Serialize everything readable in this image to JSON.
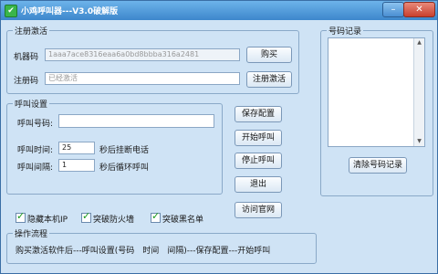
{
  "window": {
    "title": "小鸡呼叫器---V3.0破解版",
    "minimize_label": "–",
    "close_label": "✕",
    "app_icon_glyph": "✔"
  },
  "registration": {
    "legend": "注册激活",
    "machine_label": "机器码",
    "machine_value": "1aaa7ace8316eaa6a0bd8bbba316a2481",
    "buy_label": "购买",
    "code_label": "注册码",
    "code_placeholder": "已经激活",
    "register_label": "注册激活"
  },
  "call_settings": {
    "legend": "呼叫设置",
    "number_label": "呼叫号码:",
    "number_value": "",
    "time_label": "呼叫时间:",
    "time_value": "25",
    "time_suffix": "秒后挂断电话",
    "interval_label": "呼叫间隔:",
    "interval_value": "1",
    "interval_suffix": "秒后循环呼叫"
  },
  "actions": {
    "save_label": "保存配置",
    "start_label": "开始呼叫",
    "stop_label": "停止呼叫",
    "exit_label": "退出",
    "visit_label": "访问官网"
  },
  "options": {
    "hide_ip_label": "隐藏本机IP",
    "hide_ip_checked": true,
    "firewall_label": "突破防火墙",
    "firewall_checked": true,
    "blacklist_label": "突破黑名单",
    "blacklist_checked": true
  },
  "workflow": {
    "legend": "操作流程",
    "text": "购买激活软件后---呼叫设置(号码　时间　间隔)---保存配置---开始呼叫"
  },
  "log": {
    "legend": "号码记录",
    "clear_label": "清除号码记录",
    "scroll_up": "▲",
    "scroll_down": "▼"
  }
}
